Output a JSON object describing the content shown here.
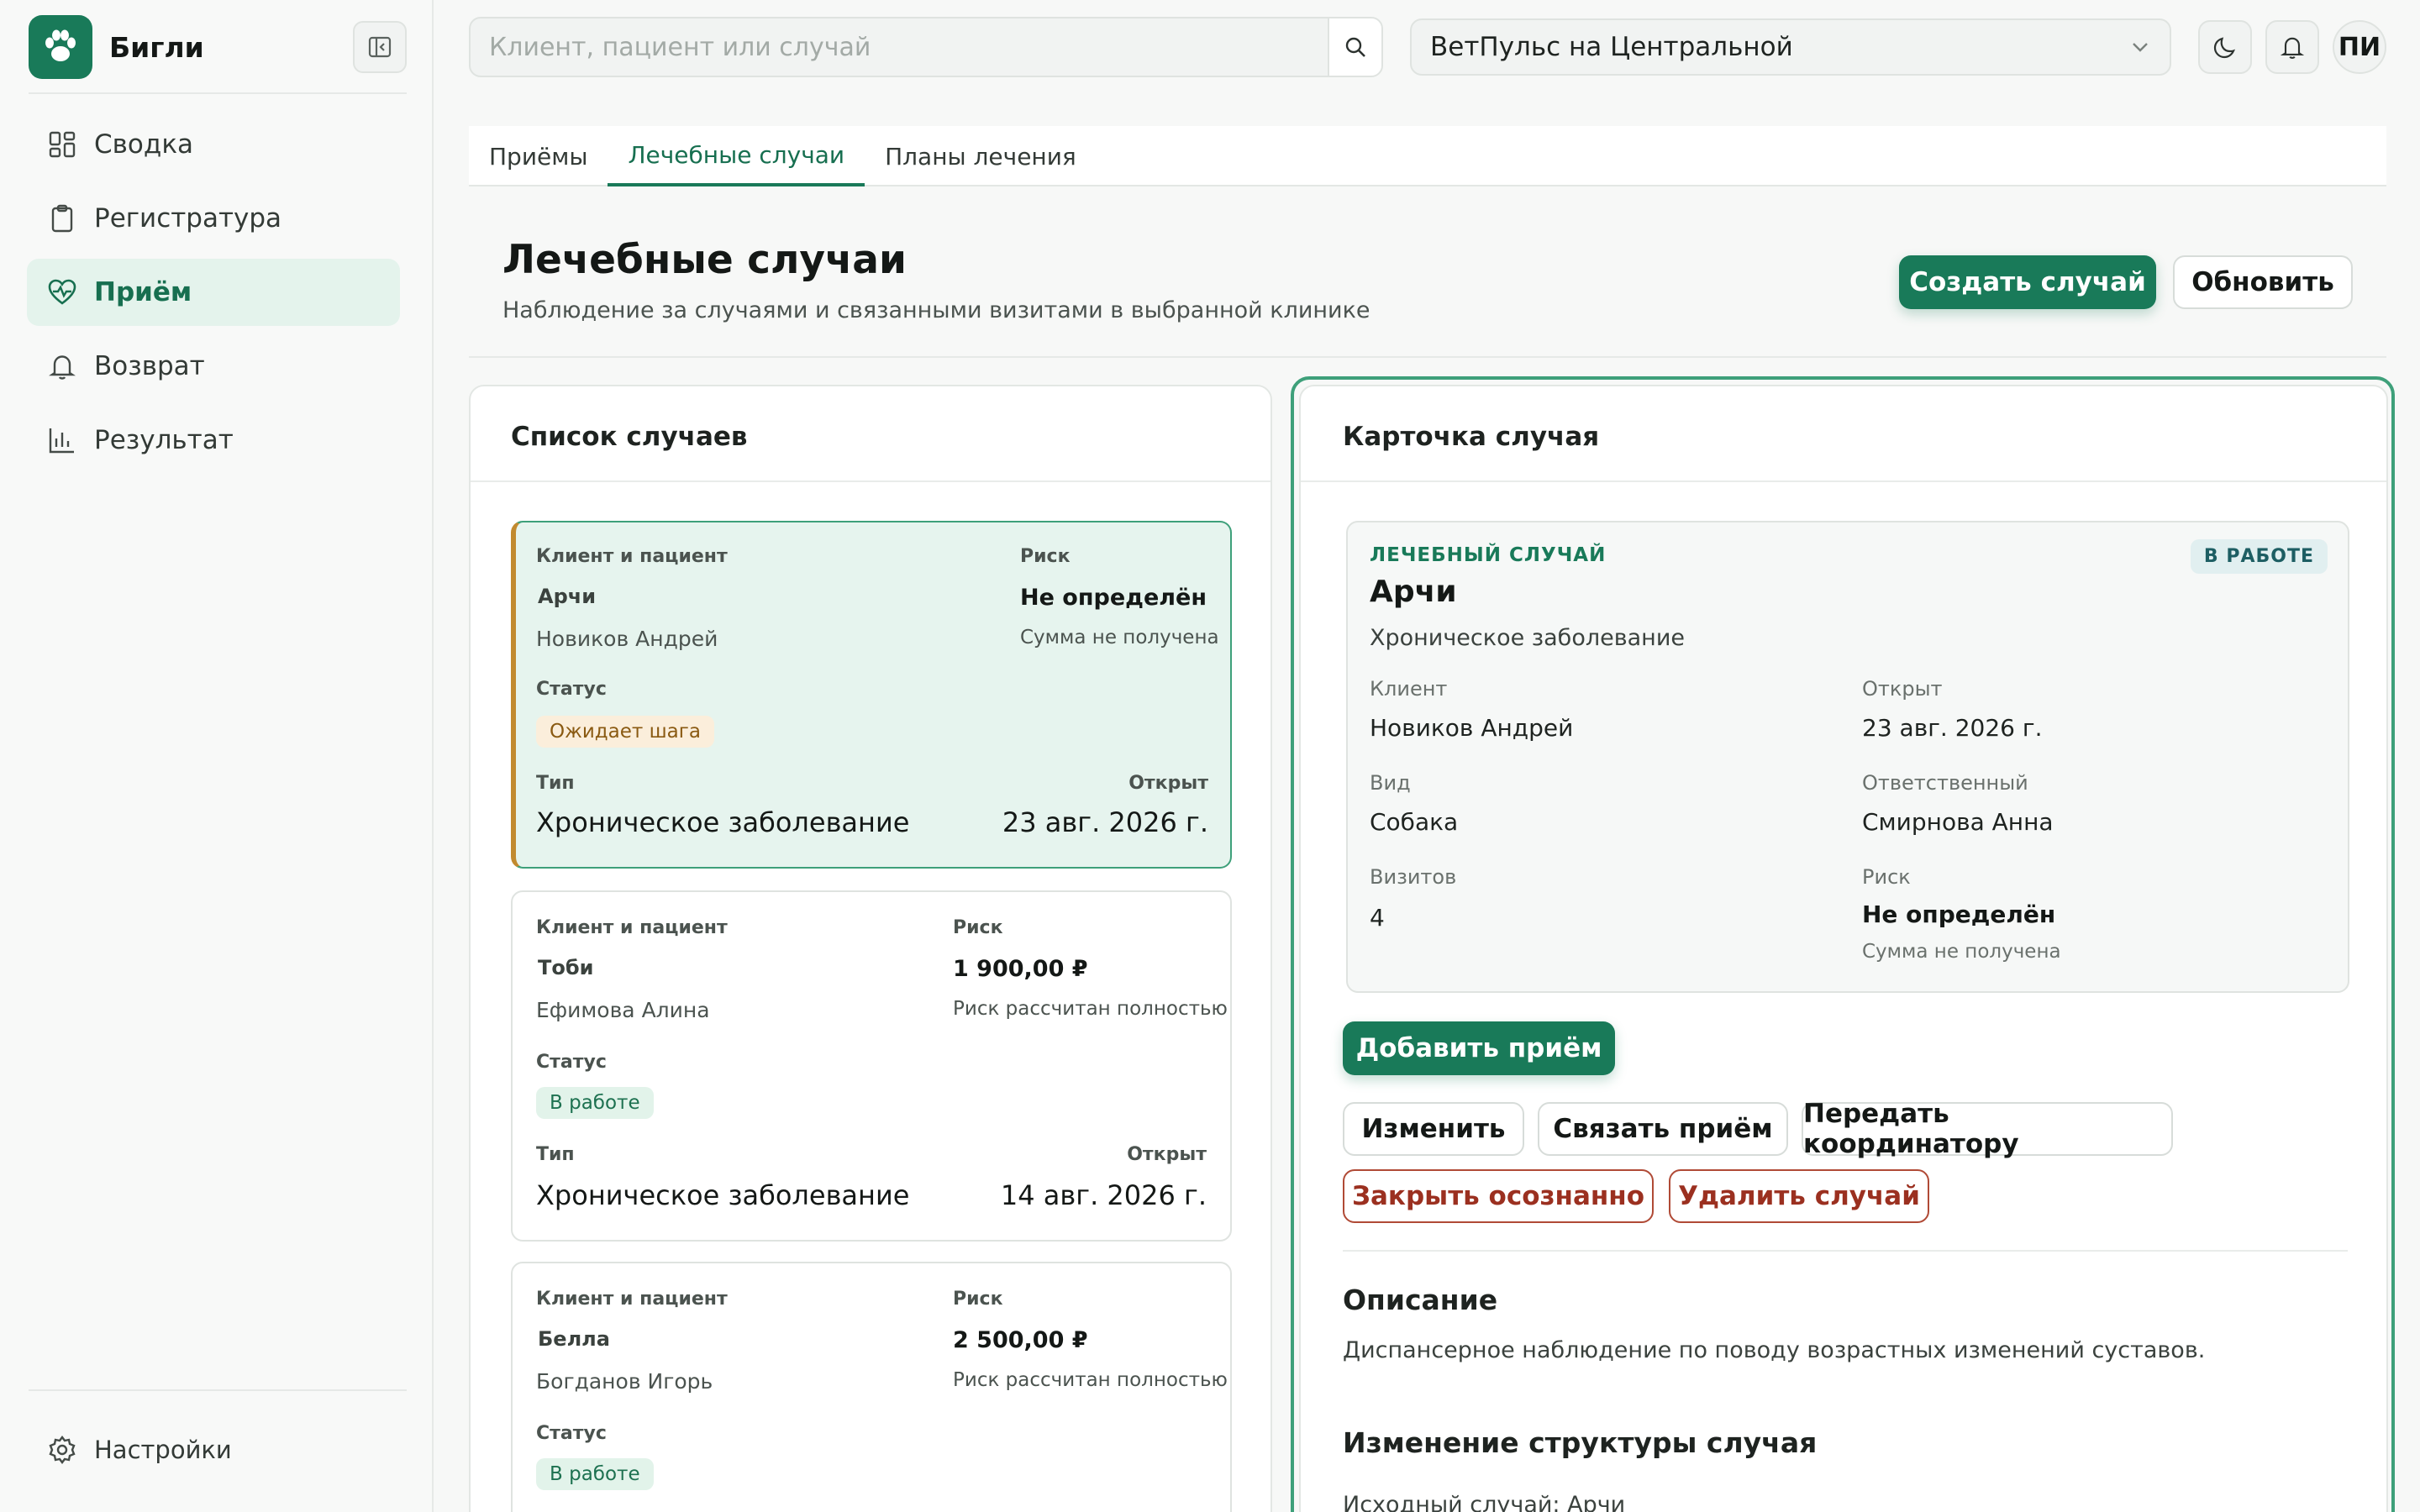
{
  "app": {
    "name": "Бигли"
  },
  "sidebar": {
    "items": [
      {
        "label": "Сводка"
      },
      {
        "label": "Регистратура"
      },
      {
        "label": "Приём"
      },
      {
        "label": "Возврат"
      },
      {
        "label": "Результат"
      }
    ],
    "settings_label": "Настройки"
  },
  "topbar": {
    "search_placeholder": "Клиент, пациент или случай",
    "clinic": "ВетПульс на Центральной",
    "avatar_initials": "ПИ"
  },
  "tabs": [
    {
      "label": "Приёмы"
    },
    {
      "label": "Лечебные случаи"
    },
    {
      "label": "Планы лечения"
    }
  ],
  "header": {
    "title": "Лечебные случаи",
    "subtitle": "Наблюдение за случаями и связанными визитами в выбранной клинике",
    "create_label": "Создать случай",
    "refresh_label": "Обновить"
  },
  "case_list": {
    "title": "Список случаев",
    "cards": [
      {
        "client_pet_label": "Клиент и пациент",
        "pet": "Арчи",
        "owner": "Новиков Андрей",
        "risk_label": "Риск",
        "risk": "Не определён",
        "risk_note": "Сумма не получена",
        "status_label": "Статус",
        "status": "Ожидает шага",
        "type_label": "Тип",
        "type": "Хроническое заболевание",
        "opened_label": "Открыт",
        "opened": "23 авг. 2026 г."
      },
      {
        "client_pet_label": "Клиент и пациент",
        "pet": "Тоби",
        "owner": "Ефимова Алина",
        "risk_label": "Риск",
        "risk": "1 900,00 ₽",
        "risk_note": "Риск рассчитан полностью",
        "status_label": "Статус",
        "status": "В работе",
        "type_label": "Тип",
        "type": "Хроническое заболевание",
        "opened_label": "Открыт",
        "opened": "14 авг. 2026 г."
      },
      {
        "client_pet_label": "Клиент и пациент",
        "pet": "Белла",
        "owner": "Богданов Игорь",
        "risk_label": "Риск",
        "risk": "2 500,00 ₽",
        "risk_note": "Риск рассчитан полностью",
        "status_label": "Статус",
        "status": "В работе"
      }
    ]
  },
  "case_detail": {
    "title": "Карточка случая",
    "kicker": "ЛЕЧЕБНЫЙ СЛУЧАЙ",
    "status_badge": "В РАБОТЕ",
    "pet": "Арчи",
    "type": "Хроническое заболевание",
    "client_label": "Клиент",
    "client": "Новиков Андрей",
    "opened_label": "Открыт",
    "opened": "23 авг. 2026 г.",
    "species_label": "Вид",
    "species": "Собака",
    "responsible_label": "Ответственный",
    "responsible": "Смирнова Анна",
    "visits_label": "Визитов",
    "visits": "4",
    "risk_label": "Риск",
    "risk": "Не определён",
    "risk_note": "Сумма не получена",
    "actions": {
      "add_visit": "Добавить приём",
      "edit": "Изменить",
      "link_visit": "Связать приём",
      "transfer": "Передать координатору",
      "close": "Закрыть осознанно",
      "delete": "Удалить случай"
    },
    "description_title": "Описание",
    "description": "Диспансерное наблюдение по поводу возрастных изменений суставов.",
    "structure_title": "Изменение структуры случая",
    "structure_note": "Исходный случай: Арчи"
  },
  "colors": {
    "accent": "#197a59",
    "accent_soft": "#e4f3ec",
    "danger": "#9b3020",
    "warning_badge": "#fbeedb"
  }
}
